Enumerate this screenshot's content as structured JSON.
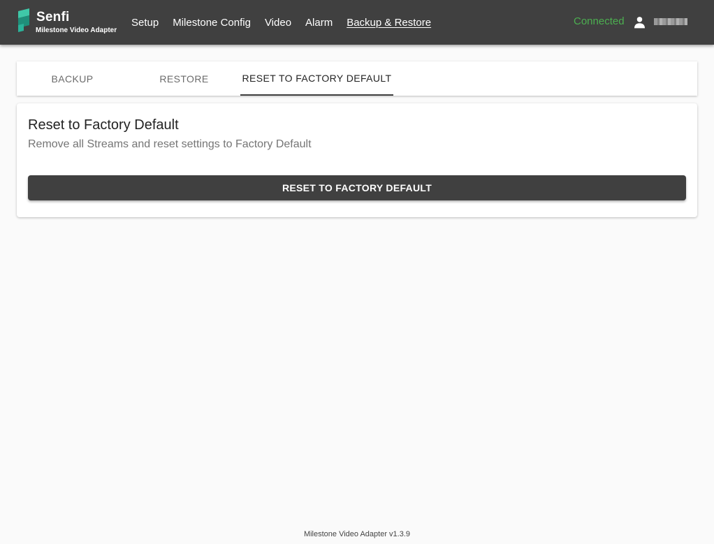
{
  "header": {
    "brand": {
      "name": "Senfi",
      "subtitle": "Milestone Video Adapter",
      "logo_icon": "senfi-logo-icon"
    },
    "nav": [
      {
        "label": "Setup",
        "active": false
      },
      {
        "label": "Milestone Config",
        "active": false
      },
      {
        "label": "Video",
        "active": false
      },
      {
        "label": "Alarm",
        "active": false
      },
      {
        "label": "Backup & Restore",
        "active": true
      }
    ],
    "status": {
      "label": "Connected",
      "color": "#4caf50"
    },
    "user": {
      "icon": "person-icon"
    }
  },
  "tabs": [
    {
      "label": "BACKUP",
      "active": false
    },
    {
      "label": "RESTORE",
      "active": false
    },
    {
      "label": "RESET TO FACTORY DEFAULT",
      "active": true
    }
  ],
  "card": {
    "title": "Reset to Factory Default",
    "subtitle": "Remove all Streams and reset settings to Factory Default",
    "button_label": "RESET TO FACTORY DEFAULT"
  },
  "footer": {
    "version_text": "Milestone Video Adapter v1.3.9"
  },
  "colors": {
    "header_bg": "#404040",
    "accent_logo": "#2bb39a",
    "button_bg": "#404040",
    "page_bg": "#fafafa"
  }
}
